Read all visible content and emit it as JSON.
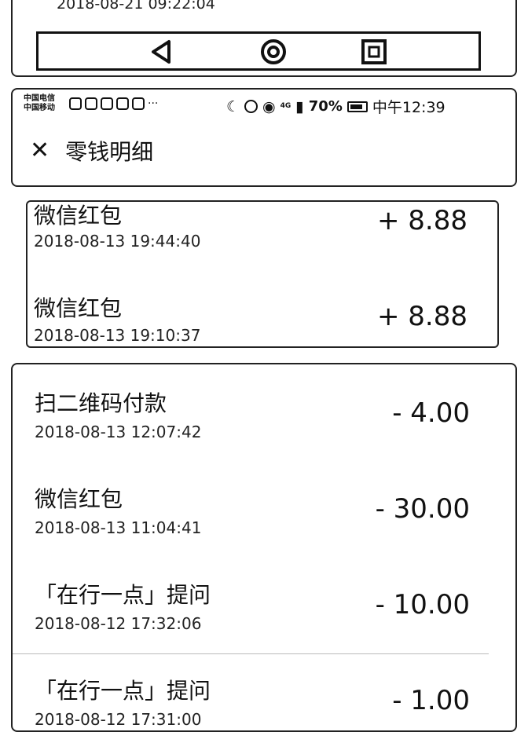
{
  "top_fragment": {
    "timestamp": "2018-08-21 09:22:04",
    "nav": {
      "back_icon": "back-triangle-icon",
      "home_icon": "home-circle-icon",
      "recent_icon": "recent-square-icon"
    }
  },
  "status_bar": {
    "carrier_1": "中国电信",
    "carrier_2": "中国移动",
    "more": "···",
    "battery_percent": "70%",
    "clock": "中午12:39",
    "network": "4G"
  },
  "header": {
    "close_icon": "close-icon",
    "title": "零钱明细"
  },
  "transactions": [
    {
      "name": "微信红包",
      "time": "2018-08-13 19:44:40",
      "amount": "+ 8.88"
    },
    {
      "name": "微信红包",
      "time": "2018-08-13 19:10:37",
      "amount": "+ 8.88"
    },
    {
      "name": "扫二维码付款",
      "time": "2018-08-13 12:07:42",
      "amount": "- 4.00"
    },
    {
      "name": "微信红包",
      "time": "2018-08-13 11:04:41",
      "amount": "- 30.00"
    },
    {
      "name": "「在行一点」提问",
      "time": "2018-08-12 17:32:06",
      "amount": "- 10.00"
    },
    {
      "name": "「在行一点」提问",
      "time": "2018-08-12 17:31:00",
      "amount": "- 1.00"
    }
  ]
}
